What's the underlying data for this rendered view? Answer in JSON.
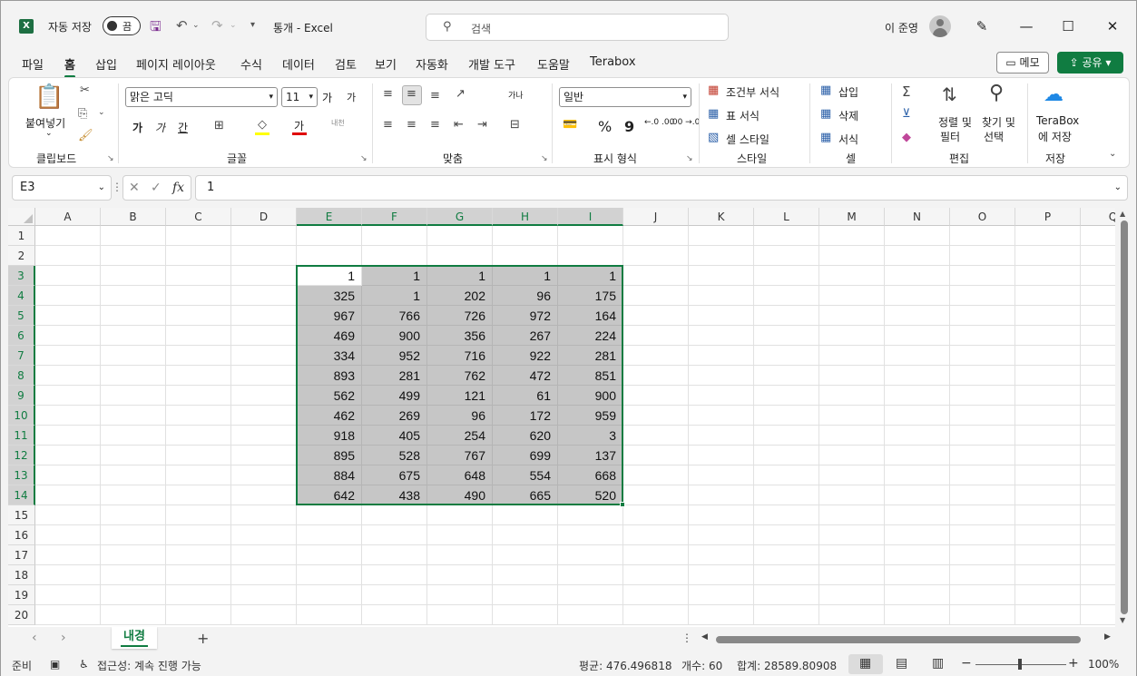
{
  "titlebar": {
    "autosave_label": "자동 저장",
    "autosave_state": "끔",
    "doc_title": "통개  -  Excel",
    "search_placeholder": "검색",
    "user_name": "이 준영"
  },
  "tabs": [
    "파일",
    "홈",
    "삽입",
    "페이지 레이아웃",
    "수식",
    "데이터",
    "검토",
    "보기",
    "자동화",
    "개발 도구",
    "도움말",
    "Terabox"
  ],
  "active_tab": "홈",
  "actions": {
    "memo": "메모",
    "share": "공유"
  },
  "ribbon": {
    "clipboard": {
      "paste": "붙여넣기",
      "label": "클립보드"
    },
    "font": {
      "name": "맑은 고딕",
      "size": "11",
      "label": "글꼴",
      "grow": "가",
      "shrink": "가",
      "bold": "가",
      "italic": "가",
      "underline": "간",
      "phonetic": "내천"
    },
    "alignment": {
      "label": "맞춤",
      "wrap": "가나"
    },
    "number": {
      "format": "일반",
      "label": "표시 형식",
      "percent": "%",
      "comma": "9",
      "inc_decimal": "←.0 .00",
      "dec_decimal": ".00 →.0"
    },
    "styles": {
      "conditional": "조건부 서식",
      "table": "표 서식",
      "cell": "셀 스타일",
      "label": "스타일"
    },
    "cells": {
      "insert": "삽입",
      "delete": "삭제",
      "format": "서식",
      "label": "셀"
    },
    "editing": {
      "sort": "정렬 및",
      "sort2": "필터",
      "find": "찾기 및",
      "find2": "선택",
      "label": "편집"
    },
    "save": {
      "terabox": "TeraBox",
      "terabox2": "에 저장",
      "label": "저장"
    }
  },
  "formula_bar": {
    "name_box": "E3",
    "value": "1"
  },
  "grid": {
    "columns": [
      "A",
      "B",
      "C",
      "D",
      "E",
      "F",
      "G",
      "H",
      "I",
      "J",
      "K",
      "L",
      "M",
      "N",
      "O",
      "P",
      "Q"
    ],
    "rows": [
      "1",
      "2",
      "3",
      "4",
      "5",
      "6",
      "7",
      "8",
      "9",
      "10",
      "11",
      "12",
      "13",
      "14",
      "15",
      "16",
      "17",
      "18",
      "19",
      "20"
    ],
    "selected_columns": [
      "E",
      "F",
      "G",
      "H",
      "I"
    ],
    "selected_rows": [
      "3",
      "4",
      "5",
      "6",
      "7",
      "8",
      "9",
      "10",
      "11",
      "12",
      "13",
      "14"
    ],
    "data": [
      [
        "1",
        "1",
        "1",
        "1",
        "1"
      ],
      [
        "325",
        "1",
        "202",
        "96",
        "175"
      ],
      [
        "967",
        "766",
        "726",
        "972",
        "164"
      ],
      [
        "469",
        "900",
        "356",
        "267",
        "224"
      ],
      [
        "334",
        "952",
        "716",
        "922",
        "281"
      ],
      [
        "893",
        "281",
        "762",
        "472",
        "851"
      ],
      [
        "562",
        "499",
        "121",
        "61",
        "900"
      ],
      [
        "462",
        "269",
        "96",
        "172",
        "959"
      ],
      [
        "918",
        "405",
        "254",
        "620",
        "3"
      ],
      [
        "895",
        "528",
        "767",
        "699",
        "137"
      ],
      [
        "884",
        "675",
        "648",
        "554",
        "668"
      ],
      [
        "642",
        "438",
        "490",
        "665",
        "520"
      ]
    ]
  },
  "sheet": {
    "name": "내경"
  },
  "status": {
    "ready": "준비",
    "accessibility": "접근성: 계속 진행 가능",
    "average": "평균: 476.496818",
    "count": "개수: 60",
    "sum": "합계: 28589.80908",
    "zoom": "100%"
  }
}
